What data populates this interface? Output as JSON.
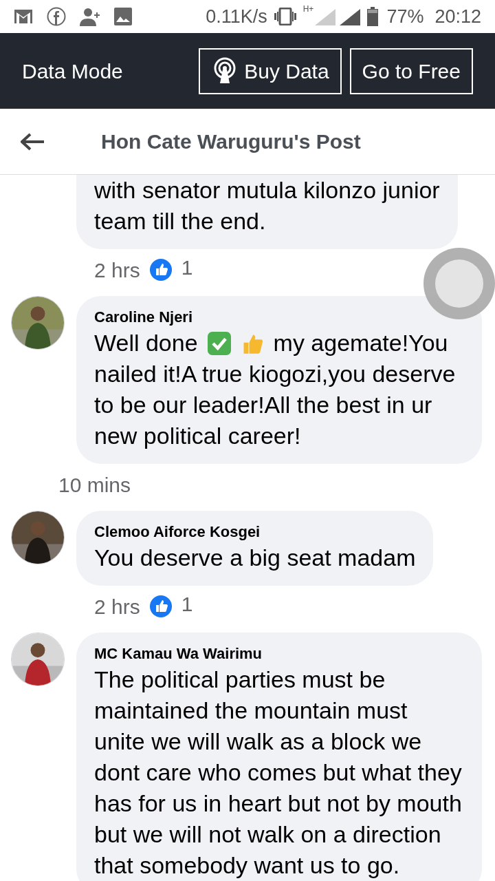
{
  "status_bar": {
    "speed": "0.11K/s",
    "network": "H+",
    "battery": "77%",
    "time": "20:12"
  },
  "top_bar": {
    "title": "Data Mode",
    "buttons": [
      {
        "label": "Buy Data",
        "kind": "signal"
      },
      {
        "label": "Go to Free",
        "kind": "plain"
      }
    ]
  },
  "header": {
    "title": "Hon Cate Waruguru's Post"
  },
  "comments": [
    {
      "lines": [
        "with senator mutula kilonzo junior",
        "team till the end."
      ],
      "time": "2 hrs",
      "likes": "1",
      "indent": false
    },
    {
      "author": "Caroline Njeri",
      "before": "Well done",
      "after": "my agemate!You",
      "lines": [
        "nailed it!A true kiogozi,you deserve to be our leader!All the best in ur new political career!"
      ],
      "time": "10 mins",
      "indent": true
    },
    {
      "author": "Clemoo Aiforce Kosgei",
      "lines": [
        "You deserve a big seat madam"
      ],
      "time": "2 hrs",
      "likes": "1",
      "indent": false
    },
    {
      "author": "MC Kamau Wa Wairimu",
      "lines": [
        "The political parties must be maintained the mountain must unite we will walk as a block we dont care who comes but what they has for us in heart but not by mouth but we will not walk on a direction that somebody want us to go."
      ]
    }
  ]
}
